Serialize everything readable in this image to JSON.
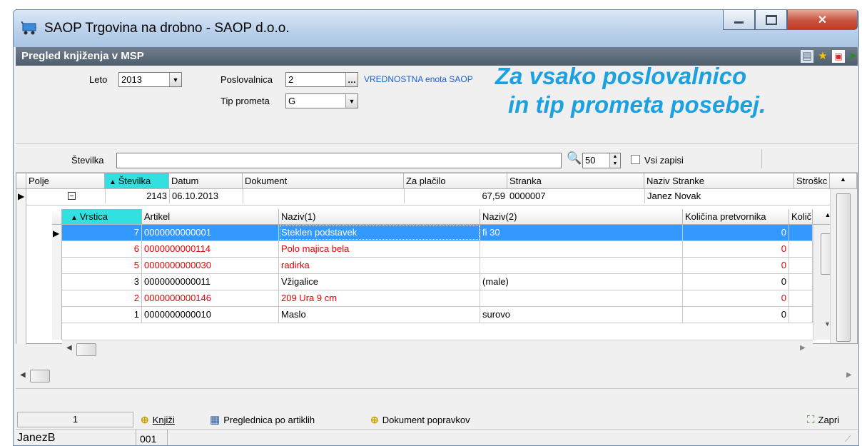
{
  "window": {
    "title": "SAOP Trgovina na drobno - SAOP d.o.o."
  },
  "subheader": {
    "title": "Pregled knjiženja v MSP"
  },
  "filters": {
    "leto_label": "Leto",
    "leto_value": "2013",
    "poslovalnica_label": "Poslovalnica",
    "poslovalnica_value": "2",
    "poslovalnica_name": "VREDNOSTNA enota SAOP",
    "tip_label": "Tip prometa",
    "tip_value": "G",
    "overlay_line1": "Za vsako poslovalnico",
    "overlay_line2": "in tip prometa posebej."
  },
  "search": {
    "label": "Številka",
    "value": "",
    "limit": "50",
    "all_label": "Vsi zapisi"
  },
  "outer_grid": {
    "headers": [
      "Polje",
      "Številka",
      "Datum",
      "Dokument",
      "Za plačilo",
      "Stranka",
      "Naziv Stranke",
      "Stroškc"
    ],
    "row": {
      "stevilka": "2143",
      "datum": "06.10.2013",
      "dokument": "",
      "za_placilo": "67,59",
      "stranka": "0000007",
      "naziv": "Janez Novak"
    }
  },
  "inner_grid": {
    "headers": [
      "Vrstica",
      "Artikel",
      "Naziv(1)",
      "Naziv(2)",
      "Količina pretvornika",
      "Količ"
    ],
    "rows": [
      {
        "vrstica": "7",
        "artikel": "0000000000001",
        "naziv1": "Steklen podstavek",
        "naziv2": "fi 30",
        "kolicina": "0"
      },
      {
        "vrstica": "6",
        "artikel": "0000000000114",
        "naziv1": "Polo majica bela",
        "naziv2": "",
        "kolicina": "0"
      },
      {
        "vrstica": "5",
        "artikel": "0000000000030",
        "naziv1": "radirka",
        "naziv2": "",
        "kolicina": "0"
      },
      {
        "vrstica": "3",
        "artikel": "0000000000011",
        "naziv1": "Vžigalice",
        "naziv2": "(male)",
        "kolicina": "0"
      },
      {
        "vrstica": "2",
        "artikel": "0000000000146",
        "naziv1": "209 Ura 9 cm",
        "naziv2": "",
        "kolicina": "0"
      },
      {
        "vrstica": "1",
        "artikel": "0000000000010",
        "naziv1": "Maslo",
        "naziv2": "surovo",
        "kolicina": "0"
      }
    ]
  },
  "bottom": {
    "record_count": "1",
    "knjizi": "Knjiži",
    "preglednica": "Preglednica po artiklih",
    "dokument": "Dokument popravkov",
    "zapri": "Zapri"
  },
  "status": {
    "user": "JanezB",
    "code": "001"
  },
  "colors": {
    "accent": "#1ba1e2",
    "selection": "#3399ff",
    "sorted_header": "#33e0e0",
    "error_text": "#e60000"
  }
}
